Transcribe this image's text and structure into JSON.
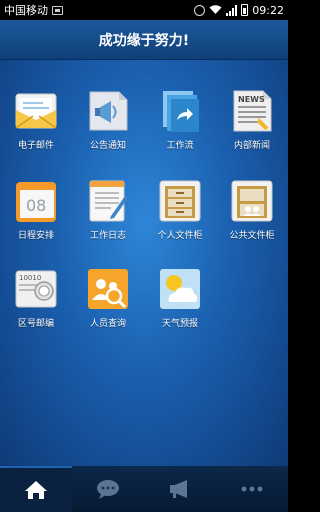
{
  "status_bar": {
    "carrier": "中国移动",
    "time": "09:22"
  },
  "header": {
    "title": "成功缘于努力!"
  },
  "apps": [
    {
      "label": "电子邮件",
      "icon": "mail-icon"
    },
    {
      "label": "公告通知",
      "icon": "megaphone-icon"
    },
    {
      "label": "工作流",
      "icon": "workflow-icon"
    },
    {
      "label": "内部新闻",
      "icon": "news-icon"
    },
    {
      "label": "日程安排",
      "icon": "calendar-icon"
    },
    {
      "label": "工作日志",
      "icon": "notebook-icon"
    },
    {
      "label": "个人文件柜",
      "icon": "cabinet-icon"
    },
    {
      "label": "公共文件柜",
      "icon": "shared-cabinet-icon"
    },
    {
      "label": "区号邮编",
      "icon": "postcode-icon"
    },
    {
      "label": "人员查询",
      "icon": "people-search-icon"
    },
    {
      "label": "天气预报",
      "icon": "weather-icon"
    }
  ],
  "calendar_day": "08",
  "postcode_stamp": "10010",
  "news_badge": "NEWS",
  "bottom_nav": [
    {
      "icon": "home-icon",
      "active": true
    },
    {
      "icon": "chat-icon",
      "active": false
    },
    {
      "icon": "megaphone-icon",
      "active": false
    },
    {
      "icon": "more-icon",
      "active": false
    }
  ]
}
